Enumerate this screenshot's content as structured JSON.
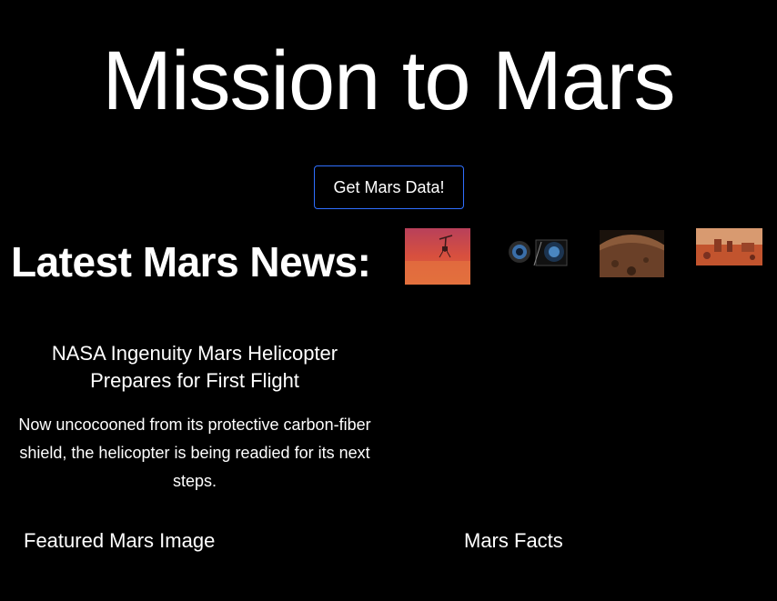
{
  "header": {
    "title": "Mission to Mars",
    "scrape_button_label": "Get Mars Data!"
  },
  "news": {
    "heading": "Latest Mars News:",
    "article_title": "NASA Ingenuity Mars Helicopter Prepares for First Flight",
    "article_teaser": "Now uncocooned from its protective carbon-fiber shield, the helicopter is being readied for its next steps."
  },
  "sections": {
    "featured_image_heading": "Featured Mars Image",
    "facts_heading": "Mars Facts"
  },
  "colors": {
    "background": "#000000",
    "text": "#ffffff",
    "button_border": "#2f6fff"
  },
  "thumbnails": [
    {
      "icon": "helicopter-on-mars-image"
    },
    {
      "icon": "camera-lens-image"
    },
    {
      "icon": "mars-surface-panorama-image"
    },
    {
      "icon": "mars-rocks-landscape-image"
    }
  ]
}
